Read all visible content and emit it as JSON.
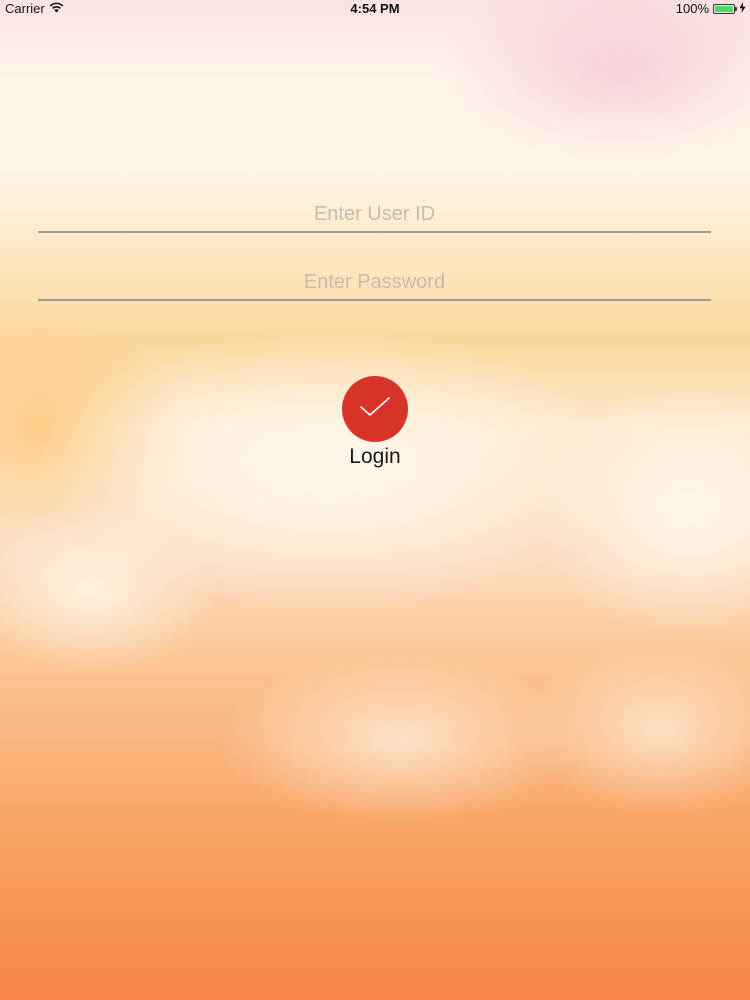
{
  "status_bar": {
    "carrier": "Carrier",
    "time": "4:54 PM",
    "battery_percent": "100%",
    "battery_level": 1.0,
    "icons": [
      "wifi-icon",
      "battery-icon",
      "charging-bolt-icon"
    ]
  },
  "login_form": {
    "user_id_placeholder": "Enter User ID",
    "user_id_value": "",
    "password_placeholder": "Enter Password",
    "password_value": "",
    "submit_icon": "checkmark-icon",
    "submit_label": "Login"
  },
  "colors": {
    "button": "#d8342a",
    "field_underline": "#9a9a96",
    "placeholder": "#c6bcb0",
    "battery_fill": "#4cd964"
  }
}
